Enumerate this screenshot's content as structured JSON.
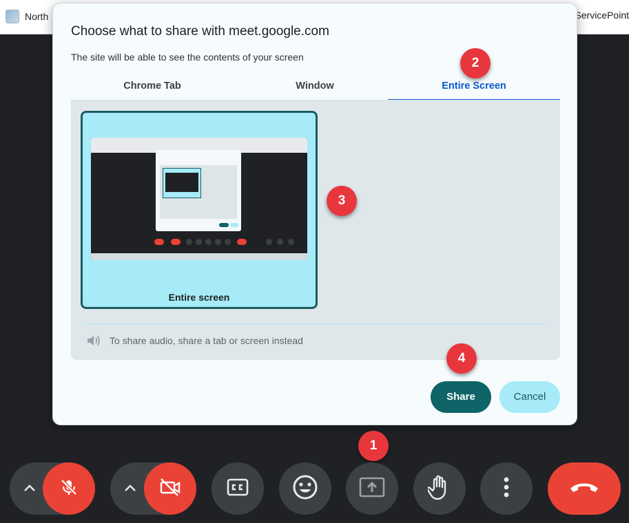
{
  "browser": {
    "bookmark_left": "North",
    "bookmark_right": "ServicePoint"
  },
  "dialog": {
    "title": "Choose what to share with meet.google.com",
    "subtitle": "The site will be able to see the contents of your screen",
    "tabs": [
      {
        "label": "Chrome Tab"
      },
      {
        "label": "Window"
      },
      {
        "label": "Entire Screen",
        "selected": true
      }
    ],
    "screen_option_label": "Entire screen",
    "audio_note": "To share audio, share a tab or screen instead",
    "share_label": "Share",
    "cancel_label": "Cancel"
  },
  "callouts": {
    "one": "1",
    "two": "2",
    "three": "3",
    "four": "4"
  },
  "colors": {
    "accent_teal": "#0e6466",
    "selected_tab": "#0b57d0",
    "light_cyan": "#a6ebf7",
    "danger_red": "#ea4335",
    "callout_red": "#e8363d"
  },
  "controls": [
    {
      "name": "mic-options",
      "icon": "chevron-up-icon"
    },
    {
      "name": "mic",
      "icon": "mic-off-icon",
      "state": "muted"
    },
    {
      "name": "camera-options",
      "icon": "chevron-up-icon"
    },
    {
      "name": "camera",
      "icon": "camera-off-icon",
      "state": "off"
    },
    {
      "name": "captions",
      "icon": "cc-icon"
    },
    {
      "name": "reactions",
      "icon": "emoji-icon"
    },
    {
      "name": "present",
      "icon": "present-screen-icon"
    },
    {
      "name": "raise-hand",
      "icon": "hand-icon"
    },
    {
      "name": "more-options",
      "icon": "more-vert-icon"
    },
    {
      "name": "leave-call",
      "icon": "call-end-icon"
    }
  ]
}
